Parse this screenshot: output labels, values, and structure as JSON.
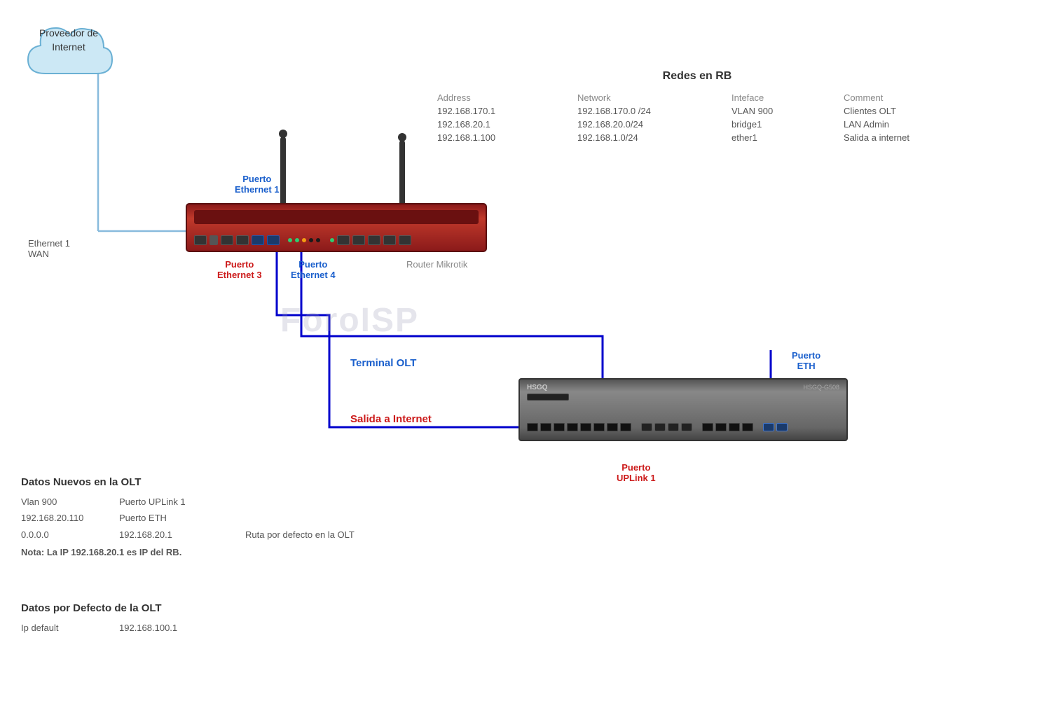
{
  "cloud": {
    "label_line1": "Proveedor de",
    "label_line2": "Internet"
  },
  "ethernet_wan": {
    "label1": "Ethernet 1",
    "label2": "WAN"
  },
  "router": {
    "label": "Router Mikrotik",
    "puerto_eth1_label": "Puerto",
    "puerto_eth1_sub": "Ethernet 1",
    "puerto_eth3_label": "Puerto",
    "puerto_eth3_sub": "Ethernet 3",
    "puerto_eth4_label": "Puerto",
    "puerto_eth4_sub": "Ethernet 4"
  },
  "olt": {
    "brand": "HSGQ",
    "model": "HSGQ-G508",
    "terminal_label": "Terminal OLT",
    "salida_label": "Salida a Internet",
    "puerto_eth_label": "Puerto",
    "puerto_eth_sub": "ETH",
    "puerto_uplink_label": "Puerto",
    "puerto_uplink_sub": "UPLink 1"
  },
  "redes_rb": {
    "title": "Redes en RB",
    "col_headers": [
      "Address",
      "Network",
      "Inteface",
      "Comment"
    ],
    "rows": [
      [
        "192.168.170.1",
        "192.168.170.0 /24",
        "VLAN 900",
        "Clientes OLT"
      ],
      [
        "192.168.20.1",
        "192.168.20.0/24",
        "bridge1",
        "LAN Admin"
      ],
      [
        "192.168.1.100",
        "192.168.1.0/24",
        "ether1",
        "Salida a internet"
      ]
    ]
  },
  "datos_nuevos": {
    "title": "Datos Nuevos en  la OLT",
    "rows": [
      {
        "col1": "Vlan 900",
        "col2": "Puerto UPLink 1",
        "col3": ""
      },
      {
        "col1": "192.168.20.110",
        "col2": "Puerto ETH",
        "col3": ""
      },
      {
        "col1": "0.0.0.0",
        "col2": "192.168.20.1",
        "col3": "Ruta  por defecto en la OLT"
      }
    ],
    "nota": "Nota: La IP 192.168.20.1 es IP del RB."
  },
  "datos_defecto": {
    "title": "Datos por Defecto de la OLT",
    "rows": [
      {
        "col1": "Ip default",
        "col2": "192.168.100.1",
        "col3": ""
      }
    ]
  },
  "foroISP": {
    "watermark": "ForoISP"
  }
}
